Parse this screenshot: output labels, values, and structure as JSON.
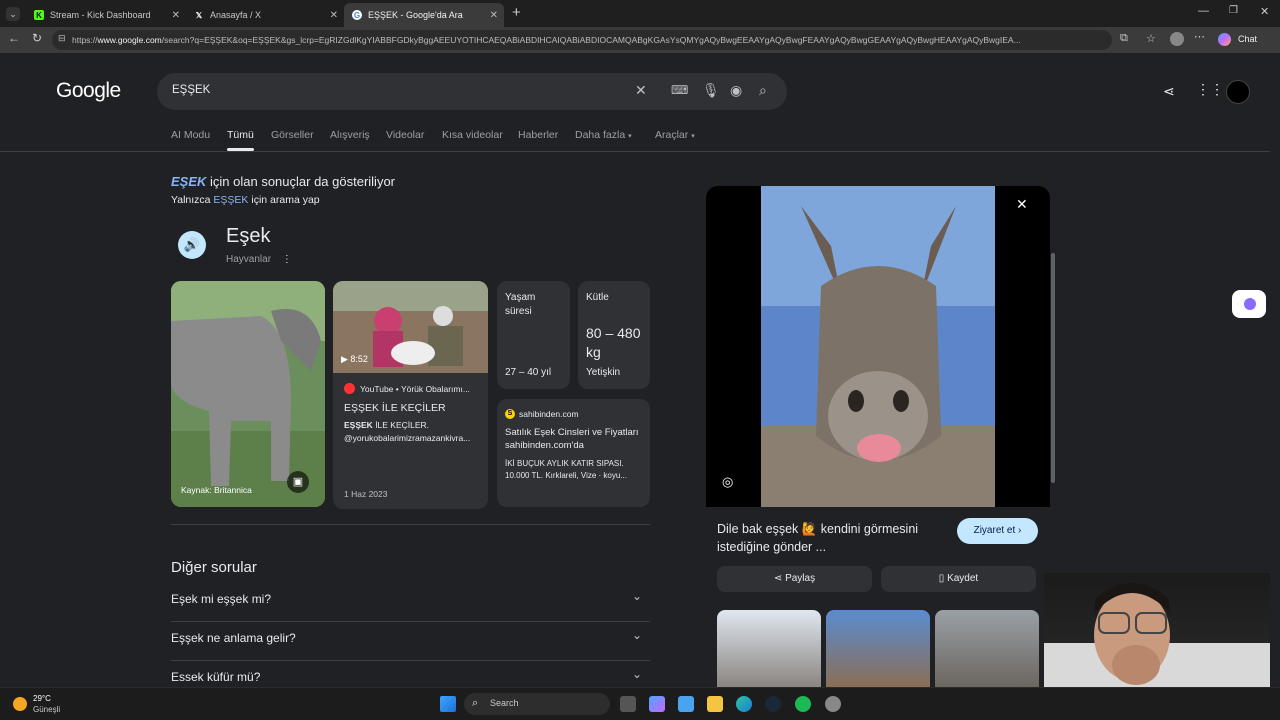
{
  "browser": {
    "tabs": [
      {
        "title": "Stream - Kick Dashboard",
        "favicon": "K"
      },
      {
        "title": "Anasayfa / X",
        "favicon": "X"
      },
      {
        "title": "EŞŞEK - Google'da Ara",
        "favicon": "G"
      }
    ],
    "url_prefix": "https://",
    "url_host": "www.google.com",
    "url_rest": "/search?q=EŞŞEK&oq=EŞŞEK&gs_lcrp=EgRIZGdlKgYIABBFGDkyBggAEEUYOTIHCAEQABiABDIHCAIQABiABDIOCAMQABgKGAsYsQMYgAQyBwgEEAAYgAQyBwgFEAAYgAQyBwgGEAAYgAQyBwgHEAAYgAQyBwgIEA...",
    "chat_label": "Chat"
  },
  "google": {
    "logo": "Google",
    "query": "EŞŞEK",
    "nav_tabs": [
      "AI Modu",
      "Tümü",
      "Görseller",
      "Alışveriş",
      "Videolar",
      "Kısa videolar",
      "Haberler",
      "Daha fazla",
      "Araçlar"
    ],
    "spell": {
      "corrected": "EŞEK",
      "corrected_suffix": " için olan sonuçlar da gösteriliyor",
      "only_prefix": "Yalnızca ",
      "only_term": "EŞŞEK",
      "only_suffix": " için arama yap"
    },
    "kp": {
      "title": "Eşek",
      "subtitle": "Hayvanlar",
      "image_source": "Kaynak: Britannica",
      "video": {
        "duration": "8:52",
        "source": "YouTube • Yörük Obalarımı...",
        "title": "EŞŞEK İLE KEÇİLER",
        "desc_bold": "EŞŞEK",
        "desc_rest": " İLE KEÇİLER.",
        "desc2": "@yorukobalarimizramazankivra...",
        "date": "1 Haz 2023"
      },
      "facts": [
        {
          "label": "Yaşam süresi",
          "value": "27 – 40 yıl"
        },
        {
          "label": "Kütle",
          "value": "80 – 480 kg",
          "sub": "Yetişkin"
        }
      ],
      "shop": {
        "site": "sahibinden.com",
        "title": "Satılık Eşek Cinsleri ve Fiyatları sahibinden.com'da",
        "desc": "İKİ BUÇUK AYLIK KATIR SIPASI. 10.000 TL. Kırklareli, Vize · koyu..."
      }
    },
    "questions_title": "Diğer sorular",
    "questions": [
      "Eşek mi eşşek mi?",
      "Eşşek ne anlama gelir?",
      "Essek küfür mü?"
    ],
    "panel": {
      "caption": "Dile bak eşşek 🙋 kendini görmesini istediğine gönder ...",
      "visit": "Ziyaret et",
      "share": "Paylaş",
      "save": "Kaydet"
    }
  },
  "taskbar": {
    "temp": "29°C",
    "weather": "Güneşli",
    "search": "Search"
  }
}
